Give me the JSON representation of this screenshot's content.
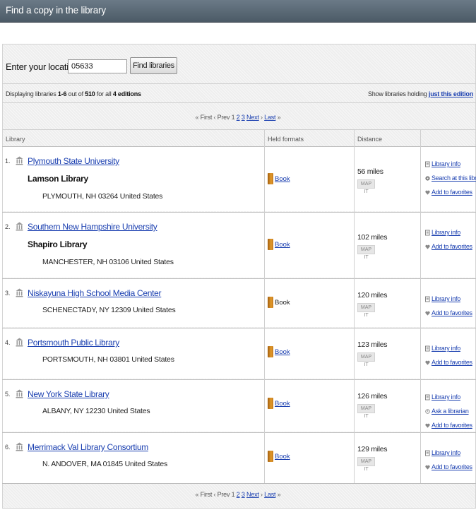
{
  "header": {
    "title": "Find a copy in the library"
  },
  "location": {
    "label": "Enter your location:",
    "value": "05633",
    "button": "Find libraries"
  },
  "summary": {
    "prefix": "Displaying libraries ",
    "range": "1-6",
    "mid": " out of ",
    "total": "510",
    "mid2": " for all ",
    "editions": "4 editions",
    "holding_prefix": "Show libraries holding ",
    "holding_link": "just this edition"
  },
  "pager": {
    "first": "First",
    "prev": "Prev",
    "p1": "1",
    "p2": "2",
    "p3": "3",
    "next": "Next",
    "last": "Last"
  },
  "columns": {
    "library": "Library",
    "formats": "Held formats",
    "distance": "Distance"
  },
  "libraries": [
    {
      "num": "1.",
      "name": "Plymouth State University",
      "branch": "Lamson Library",
      "address": "PLYMOUTH, NH 03264 United States",
      "format": "Book",
      "distance": "56 miles",
      "map": "MAP IT",
      "actions": [
        "Library info",
        "Search at this library",
        "Add to favorites"
      ]
    },
    {
      "num": "2.",
      "name": "Southern New Hampshire University",
      "branch": "Shapiro Library",
      "address": "MANCHESTER, NH 03106 United States",
      "format": "Book",
      "distance": "102 miles",
      "map": "MAP IT",
      "actions": [
        "Library info",
        "Add to favorites"
      ]
    },
    {
      "num": "3.",
      "name": "Niskayuna High School Media Center",
      "branch": "",
      "address": "SCHENECTADY, NY 12309 United States",
      "format": "Book",
      "distance": "120 miles",
      "map": "MAP IT",
      "actions": [
        "Library info",
        "Add to favorites"
      ]
    },
    {
      "num": "4.",
      "name": "Portsmouth Public Library",
      "branch": "",
      "address": "PORTSMOUTH, NH 03801 United States",
      "format": "Book",
      "distance": "123 miles",
      "map": "MAP IT",
      "actions": [
        "Library info",
        "Add to favorites"
      ]
    },
    {
      "num": "5.",
      "name": "New York State Library",
      "branch": "",
      "address": "ALBANY, NY 12230 United States",
      "format": "Book",
      "distance": "126 miles",
      "map": "MAP IT",
      "actions": [
        "Library info",
        "Ask a librarian",
        "Add to favorites"
      ]
    },
    {
      "num": "6.",
      "name": "Merrimack Val Library Consortium",
      "branch": "",
      "address": "N. ANDOVER, MA 01845 United States",
      "format": "Book",
      "distance": "129 miles",
      "map": "MAP IT",
      "actions": [
        "Library info",
        "Add to favorites"
      ]
    }
  ],
  "colors": {
    "link": "#1a3fb0",
    "header": "#56636f"
  }
}
